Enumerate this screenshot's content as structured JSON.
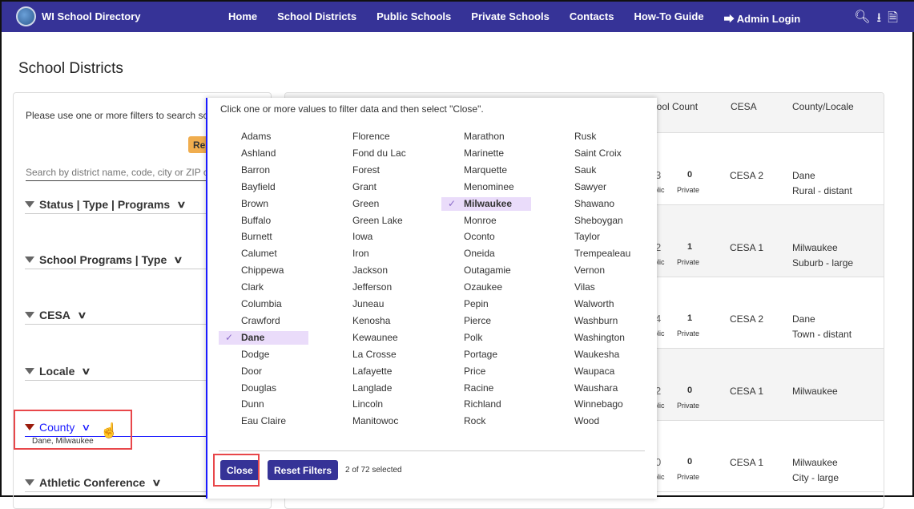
{
  "nav": {
    "brand": "WI School Directory",
    "links": [
      "Home",
      "School Districts",
      "Public Schools",
      "Private Schools",
      "Contacts",
      "How-To Guide",
      "Admin Login"
    ],
    "icons": [
      "search-icon",
      "download-icon",
      "pdf-icon"
    ]
  },
  "page_title": "School Districts",
  "left": {
    "intro": "Please use one or more filters to search school districts.",
    "reset_label": "Res",
    "search_placeholder": "Search by district name, code, city or ZIP code",
    "filters": [
      "Status | Type | Programs",
      "School Programs | Type",
      "CESA",
      "Locale",
      "County",
      "Athletic Conference"
    ],
    "county_selected": "Dane, Milwaukee"
  },
  "table": {
    "headers": [
      "hool Count",
      "CESA",
      "County/Locale"
    ],
    "rows": [
      {
        "pub": "3",
        "pub_label": "blic",
        "priv": "0",
        "priv_label": "Private",
        "cesa": "CESA 2",
        "county": "Dane",
        "locale": "Rural - distant"
      },
      {
        "pub": "2",
        "pub_label": "blic",
        "priv": "1",
        "priv_label": "Private",
        "cesa": "CESA 1",
        "county": "Milwaukee",
        "locale": "Suburb - large"
      },
      {
        "pub": "4",
        "pub_label": "blic",
        "priv": "1",
        "priv_label": "Private",
        "cesa": "CESA 2",
        "county": "Dane",
        "locale": "Town - distant"
      },
      {
        "pub": "2",
        "pub_label": "blic",
        "priv": "0",
        "priv_label": "Private",
        "cesa": "CESA 1",
        "county": "Milwaukee",
        "locale": ""
      },
      {
        "pub": "0",
        "pub_label": "blic",
        "priv": "0",
        "priv_label": "Private",
        "cesa": "CESA 1",
        "county": "Milwaukee",
        "locale": "City - large"
      }
    ]
  },
  "popup": {
    "instruction": "Click one or more values to filter data and then select \"Close\".",
    "columns": [
      [
        "Adams",
        "Ashland",
        "Barron",
        "Bayfield",
        "Brown",
        "Buffalo",
        "Burnett",
        "Calumet",
        "Chippewa",
        "Clark",
        "Columbia",
        "Crawford",
        "Dane",
        "Dodge",
        "Door",
        "Douglas",
        "Dunn",
        "Eau Claire"
      ],
      [
        "Florence",
        "Fond du Lac",
        "Forest",
        "Grant",
        "Green",
        "Green Lake",
        "Iowa",
        "Iron",
        "Jackson",
        "Jefferson",
        "Juneau",
        "Kenosha",
        "Kewaunee",
        "La Crosse",
        "Lafayette",
        "Langlade",
        "Lincoln",
        "Manitowoc"
      ],
      [
        "Marathon",
        "Marinette",
        "Marquette",
        "Menominee",
        "Milwaukee",
        "Monroe",
        "Oconto",
        "Oneida",
        "Outagamie",
        "Ozaukee",
        "Pepin",
        "Pierce",
        "Polk",
        "Portage",
        "Price",
        "Racine",
        "Richland",
        "Rock"
      ],
      [
        "Rusk",
        "Saint Croix",
        "Sauk",
        "Sawyer",
        "Shawano",
        "Sheboygan",
        "Taylor",
        "Trempealeau",
        "Vernon",
        "Vilas",
        "Walworth",
        "Washburn",
        "Washington",
        "Waukesha",
        "Waupaca",
        "Waushara",
        "Winnebago",
        "Wood"
      ]
    ],
    "selected": [
      "Dane",
      "Milwaukee"
    ],
    "check": "✓",
    "close_label": "Close",
    "reset_label": "Reset Filters",
    "count": "2 of 72 selected"
  },
  "colors": {
    "nav": "#363397",
    "accent": "#1a1aff",
    "selected_bg": "#eadcfa",
    "highlight": "#e8474a"
  }
}
